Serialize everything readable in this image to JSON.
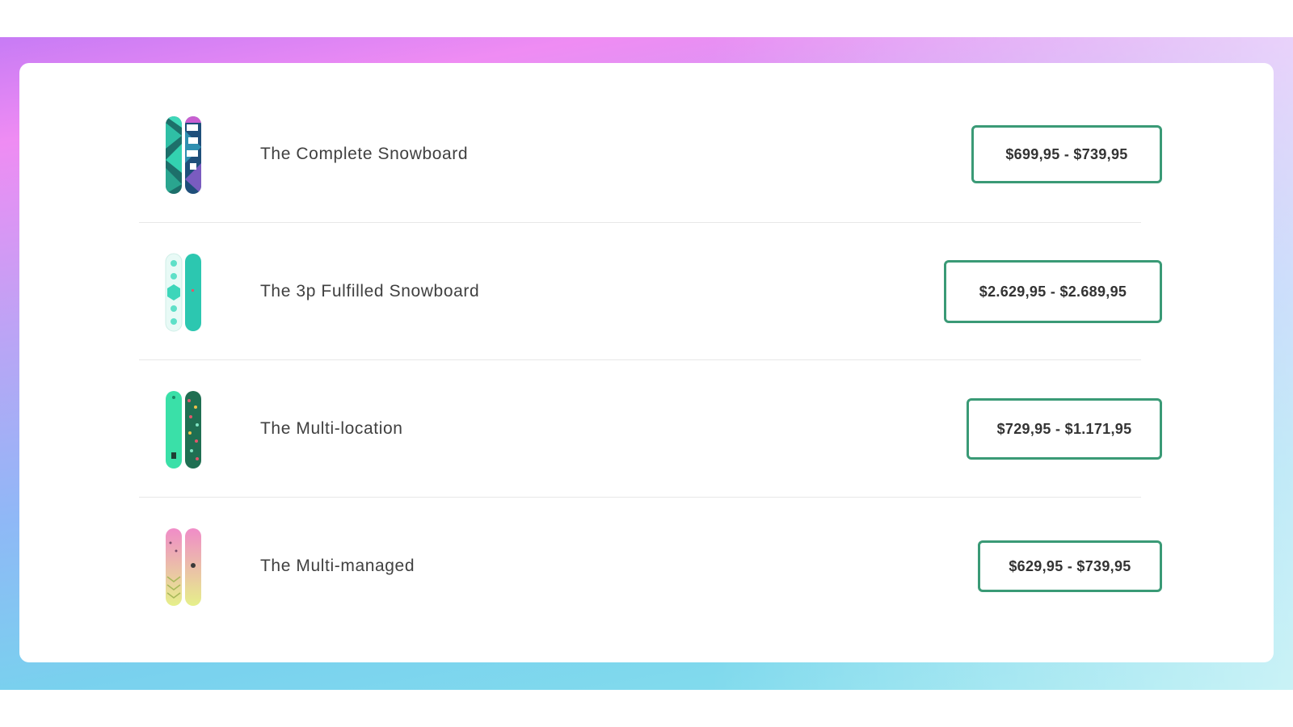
{
  "products": [
    {
      "name": "The Complete Snowboard",
      "price": "$699,95 - $739,95"
    },
    {
      "name": "The 3p Fulfilled Snowboard",
      "price": "$2.629,95 - $2.689,95"
    },
    {
      "name": "The Multi-location",
      "price": "$729,95 - $1.171,95"
    },
    {
      "name": "The Multi-managed",
      "price": "$629,95 - $739,95"
    }
  ],
  "colors": {
    "price_border": "#3a9a76",
    "divider": "#e8e8e8",
    "text": "#404040"
  }
}
